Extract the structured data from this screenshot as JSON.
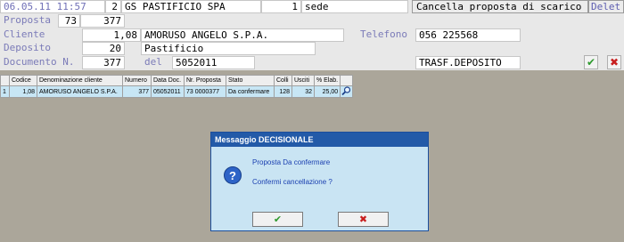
{
  "header": {
    "datetime": "06.05.11 11:57",
    "company_code": "2",
    "company_name": "GS PASTIFICIO SPA",
    "site_code": "1",
    "site_name": "sede",
    "cancel_proposal_label": "Cancella proposta di scarico",
    "delete_label": "Delet"
  },
  "form": {
    "proposta_label": "Proposta",
    "proposta_series": "73",
    "proposta_number": "377",
    "cliente_label": "Cliente",
    "cliente_code": "1,08",
    "cliente_name": "AMORUSO ANGELO S.P.A.",
    "telefono_label": "Telefono",
    "telefono_value": "056  225568",
    "deposito_label": "Deposito",
    "deposito_code": "20",
    "deposito_name": "Pastificio",
    "documento_label": "Documento N.",
    "documento_number": "377",
    "del_label": "del",
    "documento_date": "5052011",
    "doc_type": "TRASF.DEPOSITO"
  },
  "grid": {
    "columns": [
      "Codice",
      "Denominazione cliente",
      "Numero",
      "Data Doc.",
      "Nr. Proposta",
      "Stato",
      "Colli",
      "Usciti",
      "% Elab."
    ],
    "rows": [
      {
        "row_num": "1",
        "codice": "1,08",
        "denominazione": "AMORUSO ANGELO S.P.A.",
        "numero": "377",
        "data_doc": "05052011",
        "nr_proposta": "73 0000377",
        "stato": "Da confermare",
        "colli": "128",
        "usciti": "32",
        "perc_elab": "25,00"
      }
    ]
  },
  "dialog": {
    "title": "Messaggio DECISIONALE",
    "line1": "Proposta Da confermare",
    "line2": "Confermi cancellazione ?"
  },
  "icons": {
    "confirm": "check-icon",
    "cancel": "x-icon",
    "question": "question-icon",
    "zoom": "magnifier-icon"
  },
  "colors": {
    "confirm_green": "#2e9a2e",
    "cancel_red": "#c81e1e",
    "dialog_title": "#235aa8",
    "dialog_body": "#c9e4f3"
  }
}
